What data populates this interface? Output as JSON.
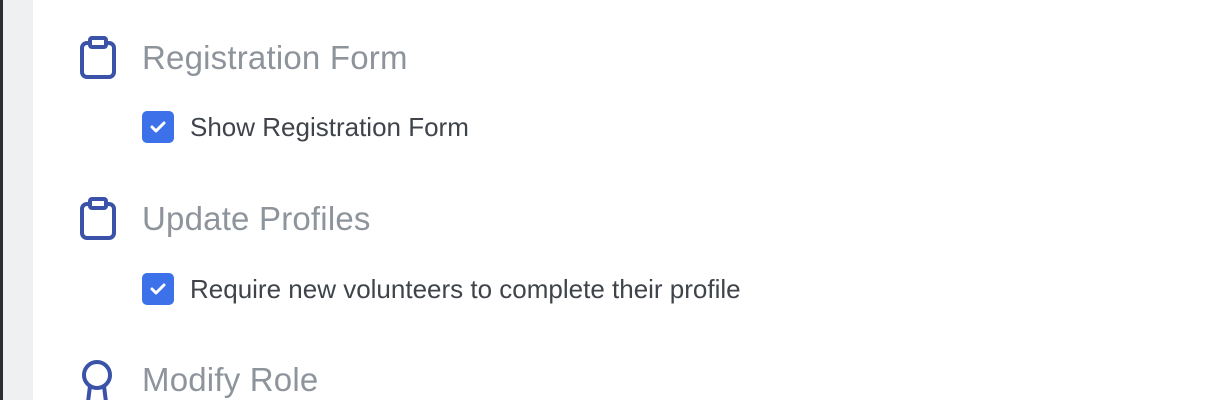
{
  "colors": {
    "accent": "#3d71ea",
    "icon": "#3a52a8",
    "heading": "#8e949b",
    "label": "#3f444b",
    "rail": "#eef0f2"
  },
  "sections": [
    {
      "title": "Registration Form",
      "icon": "clipboard-icon",
      "option": {
        "label": "Show Registration Form",
        "checked": true
      }
    },
    {
      "title": "Update Profiles",
      "icon": "clipboard-icon",
      "option": {
        "label": "Require new volunteers to complete their profile",
        "checked": true
      }
    },
    {
      "title": "Modify Role",
      "icon": "badge-icon"
    }
  ]
}
